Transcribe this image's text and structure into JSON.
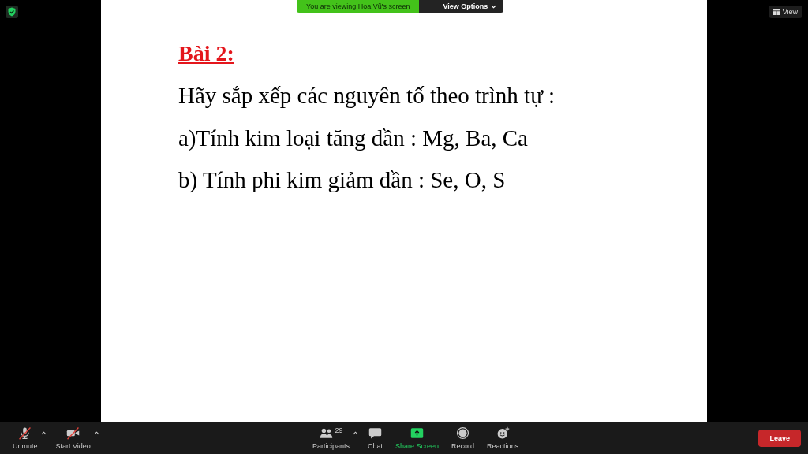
{
  "banner": {
    "text": "You are viewing Hoa Vũ's screen",
    "options": "View Options"
  },
  "view_button": "View",
  "slide": {
    "title": "Bài 2:",
    "lines": [
      "Hãy sắp xếp các nguyên tố theo trình tự :",
      "a)Tính kim loại tăng dần : Mg, Ba, Ca",
      "b) Tính phi kim giảm dần : Se, O, S"
    ]
  },
  "toolbar": {
    "left": [
      {
        "kind": "mic",
        "label": "Unmute",
        "has_menu": true,
        "crossed": true
      },
      {
        "kind": "video",
        "label": "Start Video",
        "has_menu": true,
        "crossed": true
      }
    ],
    "center": [
      {
        "kind": "participants",
        "label": "Participants",
        "count": "29",
        "has_menu": true
      },
      {
        "kind": "chat",
        "label": "Chat",
        "has_menu": false
      },
      {
        "kind": "share",
        "label": "Share Screen",
        "has_menu": false
      },
      {
        "kind": "record",
        "label": "Record",
        "has_menu": false
      },
      {
        "kind": "reactions",
        "label": "Reactions",
        "has_menu": false
      }
    ],
    "leave": "Leave"
  }
}
